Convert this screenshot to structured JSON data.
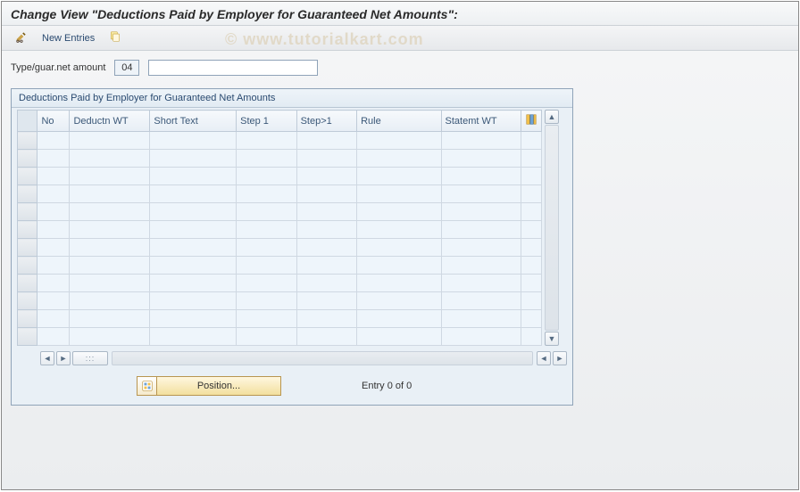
{
  "title": "Change View \"Deductions Paid by Employer for Guaranteed Net Amounts\":",
  "watermark": "© www.tutorialkart.com",
  "toolbar": {
    "new_entries_label": "New Entries"
  },
  "filter": {
    "label": "Type/guar.net amount",
    "code": "04",
    "text_value": ""
  },
  "panel": {
    "title": "Deductions Paid by Employer for Guaranteed Net Amounts",
    "columns": {
      "no": "No",
      "deductn_wt": "Deductn WT",
      "short_text": "Short Text",
      "step1": "Step 1",
      "step_gt1": "Step>1",
      "rule": "Rule",
      "statemt_wt": "Statemt WT"
    },
    "empty_row_count": 12
  },
  "footer": {
    "position_label": "Position...",
    "entry_text": "Entry 0 of 0"
  }
}
